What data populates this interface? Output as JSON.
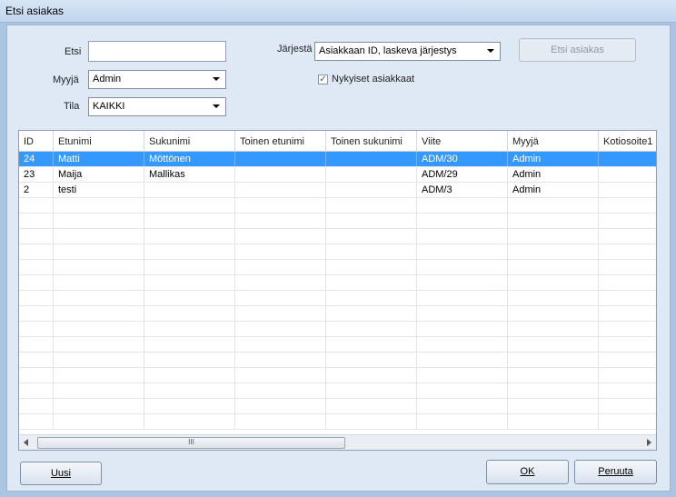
{
  "window": {
    "title": "Etsi asiakas"
  },
  "form": {
    "search_label": "Etsi",
    "search_value": "",
    "seller_label": "Myyjä",
    "seller_value": "Admin",
    "status_label": "Tila",
    "status_value": "KAIKKI",
    "order_label": "Järjestä",
    "order_value": "Asiakkaan ID, laskeva järjestys",
    "search_button": "Etsi asiakas",
    "current_customers_label": "Nykyiset asiakkaat",
    "current_customers_checked": true
  },
  "table": {
    "columns": [
      "ID",
      "Etunimi",
      "Sukunimi",
      "Toinen etunimi",
      "Toinen sukunimi",
      "Viite",
      "Myyjä",
      "Kotiosoite1"
    ],
    "rows": [
      [
        "24",
        "Matti",
        "Möttönen",
        "",
        "",
        "ADM/30",
        "Admin",
        ""
      ],
      [
        "23",
        "Maija",
        "Mallikas",
        "",
        "",
        "ADM/29",
        "Admin",
        ""
      ],
      [
        "2",
        "testi",
        "",
        "",
        "",
        "ADM/3",
        "Admin",
        ""
      ]
    ],
    "selected_row": 0,
    "scroll_thumb_label": "III"
  },
  "footer": {
    "new_button": "Uusi",
    "ok_button": "OK",
    "cancel_button": "Peruuta"
  }
}
